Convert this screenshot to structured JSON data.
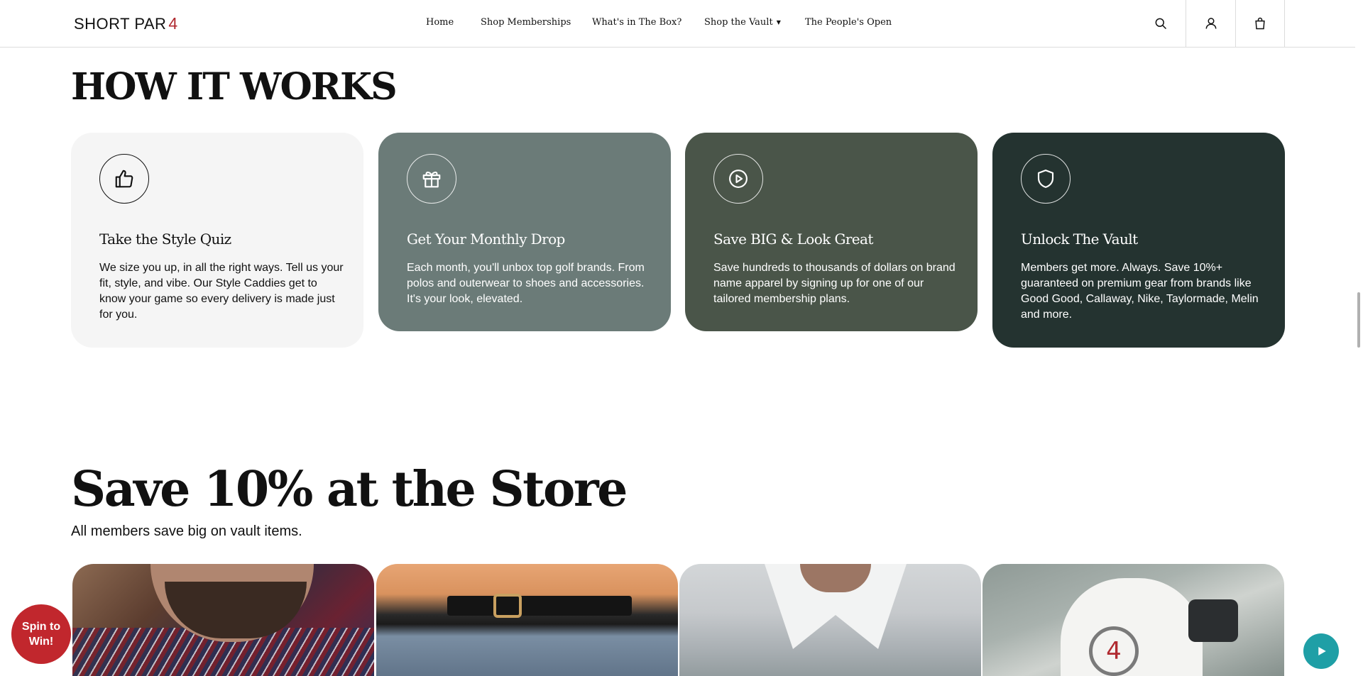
{
  "header": {
    "logo_text": "SHORT PAR",
    "logo_mark": "4",
    "nav": [
      {
        "label": "Home"
      },
      {
        "label": "Shop Memberships"
      },
      {
        "label": "What's in The Box?"
      },
      {
        "label": "Shop the Vault",
        "has_dropdown": true
      },
      {
        "label": "The People's Open"
      }
    ],
    "icons": [
      "search-icon",
      "account-icon",
      "cart-icon"
    ]
  },
  "how_it_works": {
    "title": "HOW IT WORKS",
    "cards": [
      {
        "icon": "thumbs-up-icon",
        "title": "Take the Style Quiz",
        "text": "We size you up, in all the right ways. Tell us your fit, style, and vibe. Our Style Caddies get to know your game so every delivery is made just for you.",
        "bg": "#f5f5f5"
      },
      {
        "icon": "gift-icon",
        "title": "Get Your Monthly Drop",
        "text": "Each month, you'll unbox top golf brands. From polos and outerwear to shoes and accessories. It's your look, elevated.",
        "bg": "#6b7b78"
      },
      {
        "icon": "play-circle-icon",
        "title": "Save BIG & Look Great",
        "text": "Save hundreds to thousands of dollars on brand name apparel by signing up for one of our tailored membership plans.",
        "bg": "#4a5549"
      },
      {
        "icon": "shield-icon",
        "title": "Unlock The Vault",
        "text": "Members get more. Always. Save 10%+ guaranteed on premium gear from brands like Good Good, Callaway, Nike, Taylormade, Melin and more.",
        "bg": "#243330"
      }
    ]
  },
  "store": {
    "title": "Save 10% at the Store",
    "subtitle": "All members save big on vault items."
  },
  "floating": {
    "spin_label": "Spin to Win!",
    "accent": "#c1272d",
    "play_color": "#1f9fa6"
  }
}
